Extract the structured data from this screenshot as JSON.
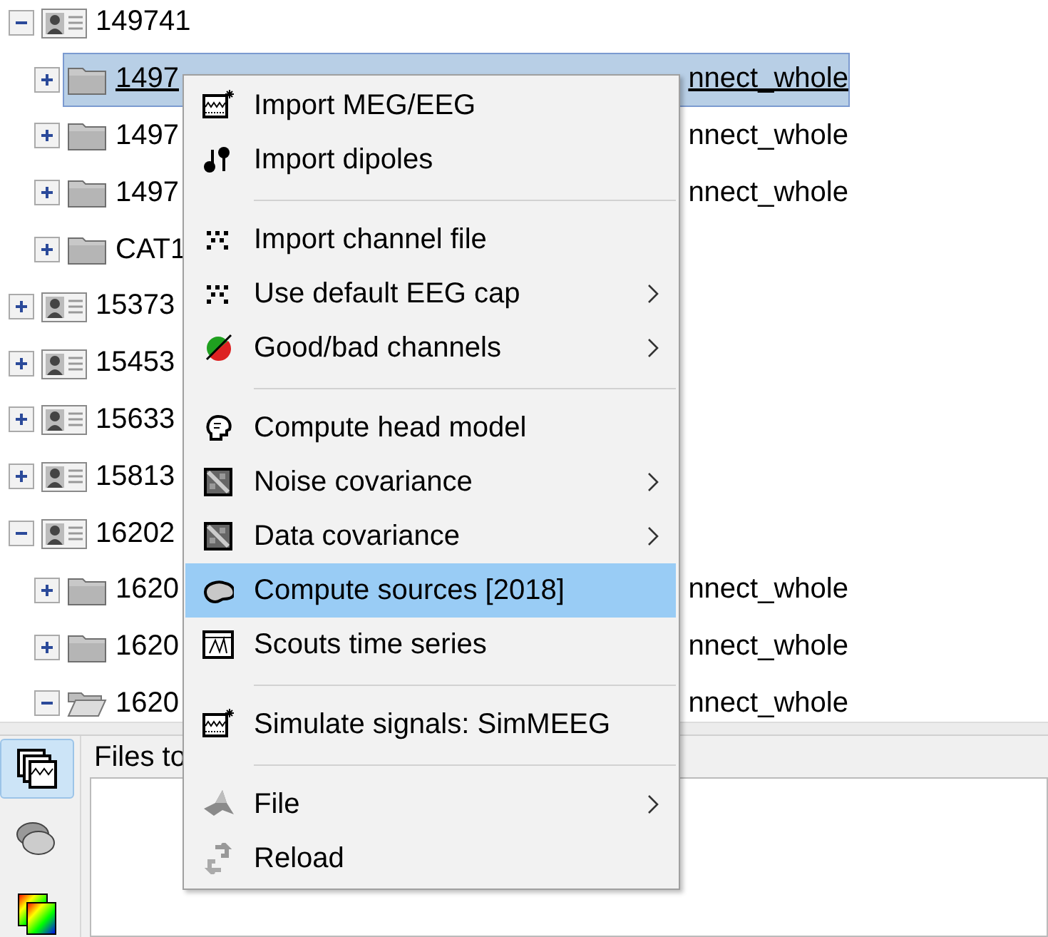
{
  "tree": [
    {
      "label": "149741",
      "kind": "subject",
      "expanded": true,
      "selected": false,
      "children": [
        {
          "label": "1497",
          "tail": "nnect_whole",
          "kind": "folder",
          "expanded": false,
          "selected": true
        },
        {
          "label": "1497",
          "tail": "nnect_whole",
          "kind": "folder",
          "expanded": false,
          "selected": false
        },
        {
          "label": "1497",
          "tail": "nnect_whole",
          "kind": "folder",
          "expanded": false,
          "selected": false
        },
        {
          "label": "CAT1",
          "kind": "folder",
          "expanded": false,
          "selected": false
        }
      ]
    },
    {
      "label": "15373",
      "kind": "subject",
      "expanded": false,
      "selected": false
    },
    {
      "label": "15453",
      "kind": "subject",
      "expanded": false,
      "selected": false
    },
    {
      "label": "15633",
      "kind": "subject",
      "expanded": false,
      "selected": false
    },
    {
      "label": "15813",
      "kind": "subject",
      "expanded": false,
      "selected": false
    },
    {
      "label": "16202",
      "kind": "subject",
      "expanded": true,
      "selected": false,
      "children": [
        {
          "label": "1620",
          "tail": "nnect_whole",
          "kind": "folder",
          "expanded": false,
          "selected": false
        },
        {
          "label": "1620",
          "tail": "nnect_whole",
          "kind": "folder",
          "expanded": false,
          "selected": false
        },
        {
          "label": "1620",
          "tail": "nnect_whole",
          "kind": "folder",
          "expanded": true,
          "selected": false
        }
      ]
    }
  ],
  "context_menu": [
    {
      "kind": "item",
      "label": "Import MEG/EEG",
      "submenu": false,
      "selected": false
    },
    {
      "kind": "item",
      "label": "Import dipoles",
      "submenu": false,
      "selected": false
    },
    {
      "kind": "separator"
    },
    {
      "kind": "item",
      "label": "Import channel file",
      "submenu": false,
      "selected": false
    },
    {
      "kind": "item",
      "label": "Use default EEG cap",
      "submenu": true,
      "selected": false
    },
    {
      "kind": "item",
      "label": "Good/bad channels",
      "submenu": true,
      "selected": false
    },
    {
      "kind": "separator"
    },
    {
      "kind": "item",
      "label": "Compute head model",
      "submenu": false,
      "selected": false
    },
    {
      "kind": "item",
      "label": "Noise covariance",
      "submenu": true,
      "selected": false
    },
    {
      "kind": "item",
      "label": "Data covariance",
      "submenu": true,
      "selected": false
    },
    {
      "kind": "item",
      "label": "Compute sources [2018]",
      "submenu": false,
      "selected": true
    },
    {
      "kind": "item",
      "label": "Scouts time series",
      "submenu": false,
      "selected": false
    },
    {
      "kind": "separator"
    },
    {
      "kind": "item",
      "label": "Simulate signals: SimMEEG",
      "submenu": false,
      "selected": false
    },
    {
      "kind": "separator"
    },
    {
      "kind": "item",
      "label": "File",
      "submenu": true,
      "selected": false
    },
    {
      "kind": "item",
      "label": "Reload",
      "submenu": false,
      "selected": false
    }
  ],
  "tool_buttons": [
    {
      "selected": true
    },
    {
      "selected": false
    },
    {
      "selected": false
    }
  ],
  "files_panel": {
    "title": "Files to"
  }
}
